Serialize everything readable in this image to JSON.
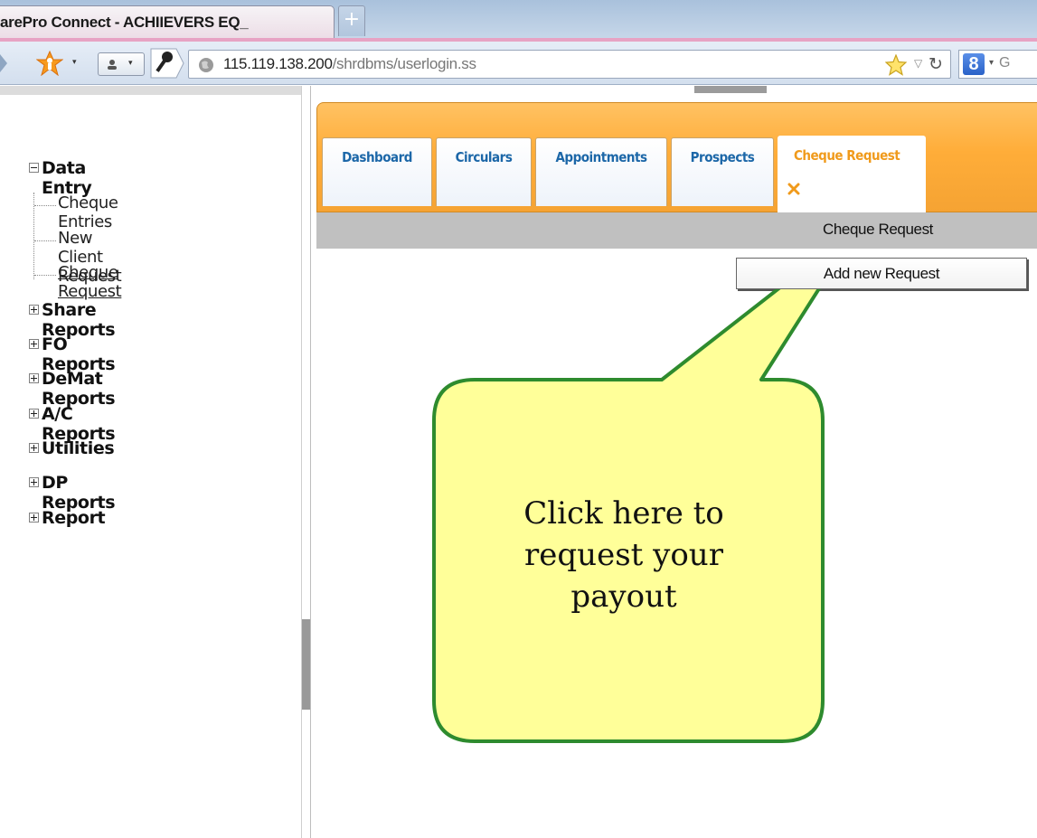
{
  "browser": {
    "tab_title": "arePro Connect - ACHIIEVERS EQ_",
    "new_tab_label": "+",
    "url_host": "115.119.138.200",
    "url_path": "/shrdbms/userlogin.ss",
    "search_engine_letter": "8",
    "search_text": "G"
  },
  "sidebar": {
    "tree": [
      {
        "label": "Data Entry",
        "expanded": true,
        "children": [
          "Cheque Entries",
          "New Client Request",
          "Cheque Request"
        ]
      },
      {
        "label": "Share Reports",
        "expanded": false
      },
      {
        "label": "FO Reports",
        "expanded": false
      },
      {
        "label": "DeMat Reports",
        "expanded": false
      },
      {
        "label": "A/C Reports",
        "expanded": false
      },
      {
        "label": "Utilities",
        "expanded": false
      },
      {
        "label": "DP Reports",
        "expanded": false
      },
      {
        "label": "Report",
        "expanded": false
      }
    ]
  },
  "main": {
    "tabs": [
      {
        "label": "Dashboard",
        "active": false
      },
      {
        "label": "Circulars",
        "active": false
      },
      {
        "label": "Appointments",
        "active": false
      },
      {
        "label": "Prospects",
        "active": false
      },
      {
        "label": "Cheque Request",
        "active": true
      }
    ],
    "section_title": "Cheque Request",
    "add_button_label": "Add new Request"
  },
  "callout": {
    "lines": [
      "Click here to",
      "request your",
      "payout"
    ]
  },
  "colors": {
    "tab_bar_orange": "#ffad39",
    "tab_label_blue": "#1c67a8",
    "active_tab_orange": "#f09a1b",
    "callout_fill": "#ffff99",
    "callout_border": "#2e8b2e"
  }
}
